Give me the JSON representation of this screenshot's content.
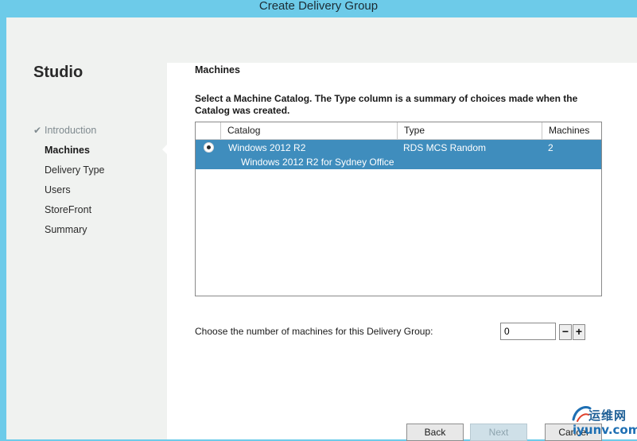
{
  "window": {
    "title": "Create Delivery Group"
  },
  "sidebar": {
    "brand": "Studio",
    "steps": [
      {
        "label": "Introduction",
        "state": "done"
      },
      {
        "label": "Machines",
        "state": "current"
      },
      {
        "label": "Delivery Type",
        "state": "pending"
      },
      {
        "label": "Users",
        "state": "pending"
      },
      {
        "label": "StoreFront",
        "state": "pending"
      },
      {
        "label": "Summary",
        "state": "pending"
      }
    ],
    "check_icon": "✔"
  },
  "main": {
    "section_title": "Machines",
    "instructions": "Select a Machine Catalog. The Type column is a summary of choices made when the Catalog was created.",
    "table": {
      "columns": [
        "Catalog",
        "Type",
        "Machines"
      ],
      "rows": [
        {
          "selected": true,
          "catalog": "Windows 2012 R2",
          "description": "Windows 2012 R2 for Sydney Office",
          "type": "RDS MCS Random",
          "machines": "2"
        }
      ]
    },
    "machine_count": {
      "label": "Choose the number of machines for this Delivery Group:",
      "value": "0",
      "decrement": "−",
      "increment": "+"
    }
  },
  "footer": {
    "back": "Back",
    "next": "Next",
    "cancel": "Cancel"
  },
  "watermark": {
    "cn": "运维网",
    "url": "iyunv.com"
  },
  "colors": {
    "title_bar": "#6dcbe9",
    "selection": "#3f8dbd",
    "sidebar_bg": "#f0f2f0",
    "content_bg": "#ffffff"
  }
}
